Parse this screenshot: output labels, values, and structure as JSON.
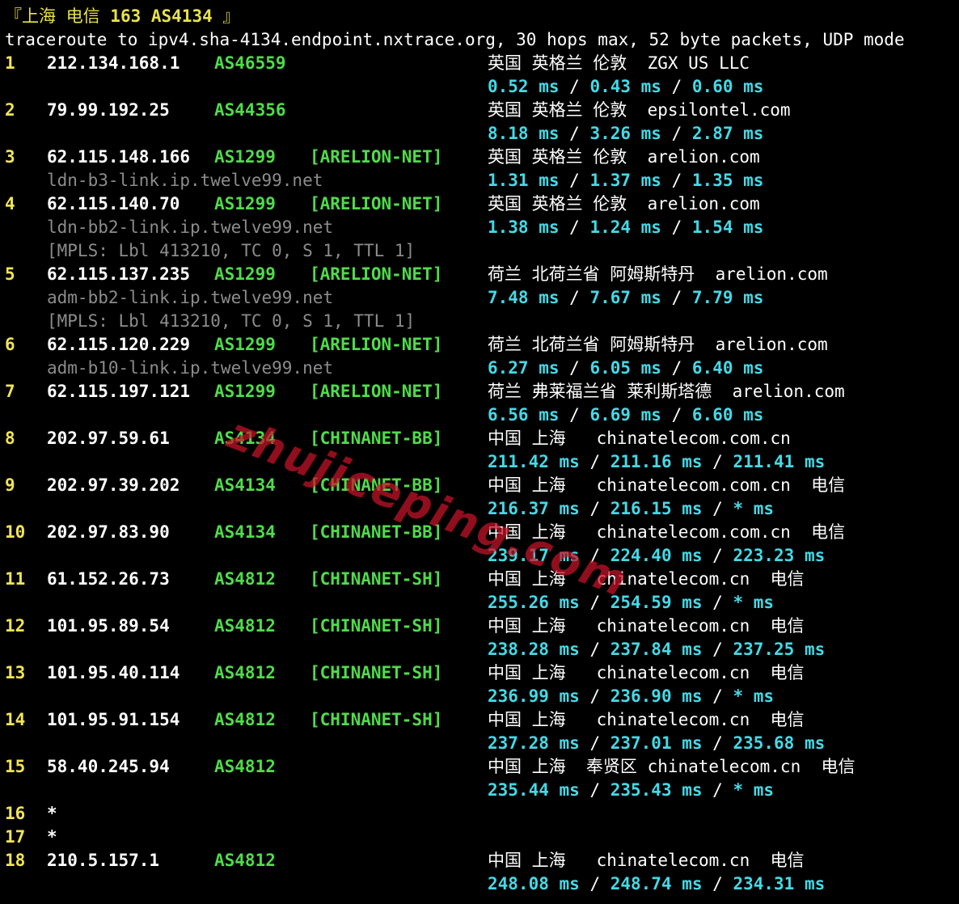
{
  "header": {
    "title_prefix": "『上海 电信 ",
    "title_bold": "163 AS4134",
    "title_suffix": " 』",
    "command_line": "traceroute to ipv4.sha-4134.endpoint.nxtrace.org, 30 hops max, 52 byte packets, UDP mode"
  },
  "hops": [
    {
      "num": "1",
      "ip": "212.134.168.1",
      "asn": "AS46559",
      "tag": "",
      "geo": "英国 英格兰 伦敦  ZGX US LLC",
      "rdns": "",
      "mpls": "",
      "rtt": [
        "0.52 ms",
        "0.43 ms",
        "0.60 ms"
      ]
    },
    {
      "num": "2",
      "ip": "79.99.192.25",
      "asn": "AS44356",
      "tag": "",
      "geo": "英国 英格兰 伦敦  epsilontel.com",
      "rdns": "",
      "mpls": "",
      "rtt": [
        "8.18 ms",
        "3.26 ms",
        "2.87 ms"
      ]
    },
    {
      "num": "3",
      "ip": "62.115.148.166",
      "asn": "AS1299",
      "tag": "[ARELION-NET]",
      "geo": "英国 英格兰 伦敦  arelion.com",
      "rdns": "ldn-b3-link.ip.twelve99.net",
      "mpls": "",
      "rtt": [
        "1.31 ms",
        "1.37 ms",
        "1.35 ms"
      ]
    },
    {
      "num": "4",
      "ip": "62.115.140.70",
      "asn": "AS1299",
      "tag": "[ARELION-NET]",
      "geo": "英国 英格兰 伦敦  arelion.com",
      "rdns": "ldn-bb2-link.ip.twelve99.net",
      "mpls": "[MPLS: Lbl 413210, TC 0, S 1, TTL 1]",
      "rtt": [
        "1.38 ms",
        "1.24 ms",
        "1.54 ms"
      ]
    },
    {
      "num": "5",
      "ip": "62.115.137.235",
      "asn": "AS1299",
      "tag": "[ARELION-NET]",
      "geo": "荷兰 北荷兰省 阿姆斯特丹  arelion.com",
      "rdns": "adm-bb2-link.ip.twelve99.net",
      "mpls": "[MPLS: Lbl 413210, TC 0, S 1, TTL 1]",
      "rtt": [
        "7.48 ms",
        "7.67 ms",
        "7.79 ms"
      ]
    },
    {
      "num": "6",
      "ip": "62.115.120.229",
      "asn": "AS1299",
      "tag": "[ARELION-NET]",
      "geo": "荷兰 北荷兰省 阿姆斯特丹  arelion.com",
      "rdns": "adm-b10-link.ip.twelve99.net",
      "mpls": "",
      "rtt": [
        "6.27 ms",
        "6.05 ms",
        "6.40 ms"
      ]
    },
    {
      "num": "7",
      "ip": "62.115.197.121",
      "asn": "AS1299",
      "tag": "[ARELION-NET]",
      "geo": "荷兰 弗莱福兰省 莱利斯塔德  arelion.com",
      "rdns": "",
      "mpls": "",
      "rtt": [
        "6.56 ms",
        "6.69 ms",
        "6.60 ms"
      ]
    },
    {
      "num": "8",
      "ip": "202.97.59.61",
      "asn": "AS4134",
      "tag": "[CHINANET-BB]",
      "geo": "中国 上海   chinatelecom.com.cn",
      "rdns": "",
      "mpls": "",
      "rtt": [
        "211.42 ms",
        "211.16 ms",
        "211.41 ms"
      ]
    },
    {
      "num": "9",
      "ip": "202.97.39.202",
      "asn": "AS4134",
      "tag": "[CHINANET-BB]",
      "geo": "中国 上海   chinatelecom.com.cn  电信",
      "rdns": "",
      "mpls": "",
      "rtt": [
        "216.37 ms",
        "216.15 ms",
        "* ms"
      ]
    },
    {
      "num": "10",
      "ip": "202.97.83.90",
      "asn": "AS4134",
      "tag": "[CHINANET-BB]",
      "geo": "中国 上海   chinatelecom.com.cn  电信",
      "rdns": "",
      "mpls": "",
      "rtt": [
        "239.17 ms",
        "224.40 ms",
        "223.23 ms"
      ]
    },
    {
      "num": "11",
      "ip": "61.152.26.73",
      "asn": "AS4812",
      "tag": "[CHINANET-SH]",
      "geo": "中国 上海   chinatelecom.cn  电信",
      "rdns": "",
      "mpls": "",
      "rtt": [
        "255.26 ms",
        "254.59 ms",
        "* ms"
      ]
    },
    {
      "num": "12",
      "ip": "101.95.89.54",
      "asn": "AS4812",
      "tag": "[CHINANET-SH]",
      "geo": "中国 上海   chinatelecom.cn  电信",
      "rdns": "",
      "mpls": "",
      "rtt": [
        "238.28 ms",
        "237.84 ms",
        "237.25 ms"
      ]
    },
    {
      "num": "13",
      "ip": "101.95.40.114",
      "asn": "AS4812",
      "tag": "[CHINANET-SH]",
      "geo": "中国 上海   chinatelecom.cn  电信",
      "rdns": "",
      "mpls": "",
      "rtt": [
        "236.99 ms",
        "236.90 ms",
        "* ms"
      ]
    },
    {
      "num": "14",
      "ip": "101.95.91.154",
      "asn": "AS4812",
      "tag": "[CHINANET-SH]",
      "geo": "中国 上海   chinatelecom.cn  电信",
      "rdns": "",
      "mpls": "",
      "rtt": [
        "237.28 ms",
        "237.01 ms",
        "235.68 ms"
      ]
    },
    {
      "num": "15",
      "ip": "58.40.245.94",
      "asn": "AS4812",
      "tag": "",
      "geo": "中国 上海  奉贤区 chinatelecom.cn  电信",
      "rdns": "",
      "mpls": "",
      "rtt": [
        "235.44 ms",
        "235.43 ms",
        "* ms"
      ]
    },
    {
      "num": "16",
      "ip": "*",
      "asn": "",
      "tag": "",
      "geo": "",
      "rdns": "",
      "mpls": "",
      "rtt": []
    },
    {
      "num": "17",
      "ip": "*",
      "asn": "",
      "tag": "",
      "geo": "",
      "rdns": "",
      "mpls": "",
      "rtt": []
    },
    {
      "num": "18",
      "ip": "210.5.157.1",
      "asn": "AS4812",
      "tag": "",
      "geo": "中国 上海   chinatelecom.cn  电信",
      "rdns": "",
      "mpls": "",
      "rtt": [
        "248.08 ms",
        "248.74 ms",
        "234.31 ms"
      ]
    }
  ],
  "rtt_separator": " / ",
  "watermark": "zhujiceping.com",
  "colors": {
    "background": "#000000",
    "hop_number": "#f1e456",
    "asn": "#4fdc4a",
    "rtt": "#44d9e6",
    "rdns": "#8c8c8c",
    "watermark": "#c81428"
  }
}
